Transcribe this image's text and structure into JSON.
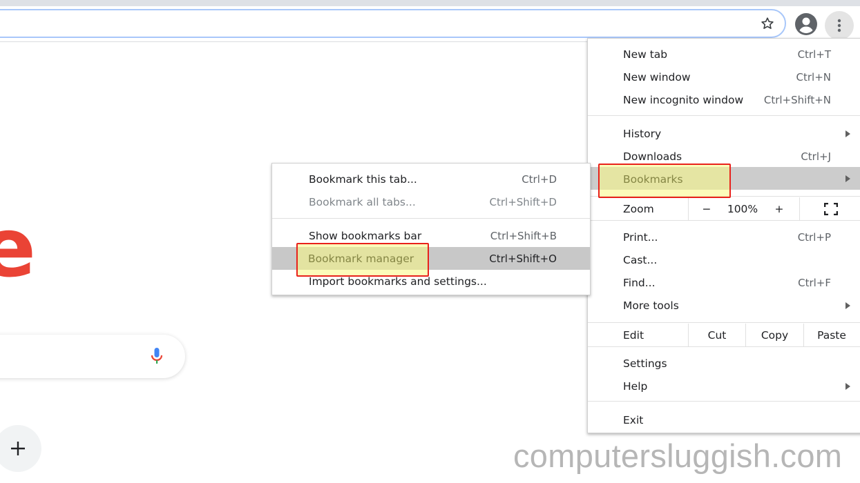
{
  "browser": {
    "toolbar": {
      "bookmark_star_icon": "star-outline",
      "profile_icon": "account-circle",
      "menu_icon": "three-dots-vertical"
    }
  },
  "page": {
    "logo_fragment": "e",
    "search_mic_icon": "microphone",
    "add_shortcut_icon": "plus"
  },
  "menu": {
    "items": [
      {
        "label": "New tab",
        "shortcut": "Ctrl+T"
      },
      {
        "label": "New window",
        "shortcut": "Ctrl+N"
      },
      {
        "label": "New incognito window",
        "shortcut": "Ctrl+Shift+N"
      },
      {
        "label": "History",
        "submenu": true
      },
      {
        "label": "Downloads",
        "shortcut": "Ctrl+J"
      },
      {
        "label": "Bookmarks",
        "submenu": true,
        "highlighted": true
      },
      {
        "label": "Print...",
        "shortcut": "Ctrl+P"
      },
      {
        "label": "Cast..."
      },
      {
        "label": "Find...",
        "shortcut": "Ctrl+F"
      },
      {
        "label": "More tools",
        "submenu": true
      },
      {
        "label": "Settings"
      },
      {
        "label": "Help",
        "submenu": true
      },
      {
        "label": "Exit"
      }
    ],
    "zoom": {
      "label": "Zoom",
      "minus": "−",
      "value": "100%",
      "plus": "+",
      "fullscreen_icon": "fullscreen"
    },
    "edit": {
      "label": "Edit",
      "cut": "Cut",
      "copy": "Copy",
      "paste": "Paste"
    }
  },
  "bookmarks_submenu": {
    "items": [
      {
        "label": "Bookmark this tab...",
        "shortcut": "Ctrl+D"
      },
      {
        "label": "Bookmark all tabs...",
        "shortcut": "Ctrl+Shift+D",
        "disabled": true
      },
      {
        "label": "Show bookmarks bar",
        "shortcut": "Ctrl+Shift+B"
      },
      {
        "label": "Bookmark manager",
        "shortcut": "Ctrl+Shift+O",
        "highlighted": true
      },
      {
        "label": "Import bookmarks and settings..."
      }
    ]
  },
  "annotations": {
    "highlight_color": "#e8211b",
    "highlight_fill": "#fafa82"
  },
  "watermark": "computersluggish.com"
}
